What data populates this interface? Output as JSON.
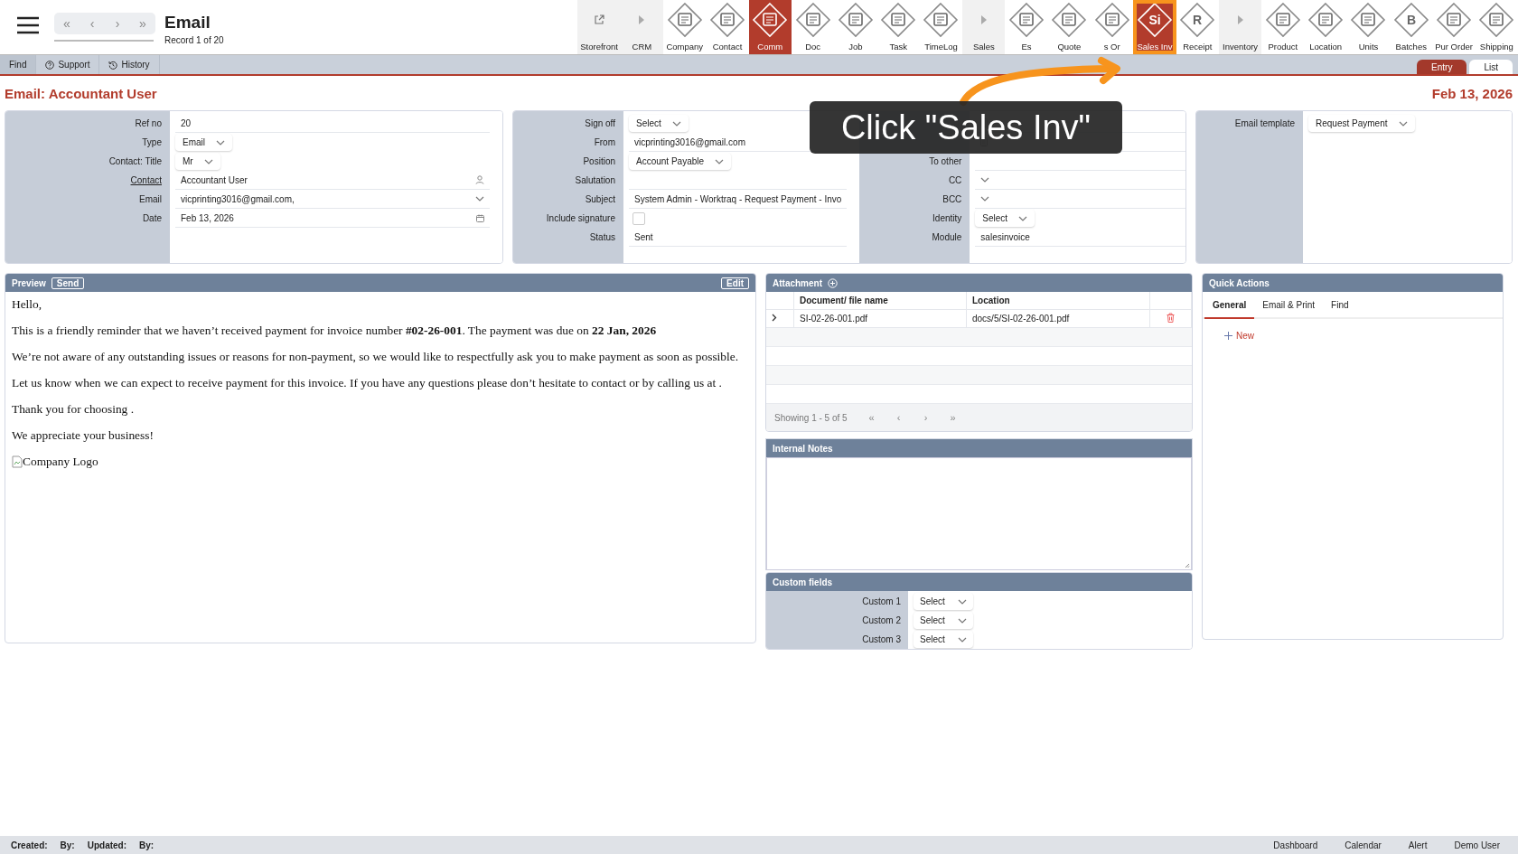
{
  "header": {
    "nav": [
      "«",
      "‹",
      "›",
      "»"
    ],
    "title": "Email",
    "record": "Record 1 of 20",
    "tools": [
      {
        "label": "Storefront",
        "kind": "link",
        "active": false,
        "highlighted": false
      },
      {
        "label": "CRM",
        "kind": "section",
        "active": false,
        "highlighted": false
      },
      {
        "label": "Company",
        "kind": "module",
        "active": false,
        "highlighted": false
      },
      {
        "label": "Contact",
        "kind": "module",
        "active": false,
        "highlighted": false
      },
      {
        "label": "Comm",
        "kind": "module",
        "active": true,
        "highlighted": false
      },
      {
        "label": "Doc",
        "kind": "module",
        "active": false,
        "highlighted": false
      },
      {
        "label": "Job",
        "kind": "module",
        "active": false,
        "highlighted": false
      },
      {
        "label": "Task",
        "kind": "module",
        "active": false,
        "highlighted": false
      },
      {
        "label": "TimeLog",
        "kind": "module",
        "active": false,
        "highlighted": false
      },
      {
        "label": "Sales",
        "kind": "section",
        "active": false,
        "highlighted": false
      },
      {
        "label": "Es",
        "kind": "module",
        "active": false,
        "highlighted": false
      },
      {
        "label": "Quote",
        "kind": "module",
        "active": false,
        "highlighted": false
      },
      {
        "label": "s Or",
        "kind": "module",
        "active": false,
        "highlighted": false
      },
      {
        "label": "Sales Inv",
        "kind": "module",
        "glyph": "Si",
        "active": true,
        "highlighted": true
      },
      {
        "label": "Receipt",
        "kind": "module",
        "glyph": "R",
        "active": false,
        "highlighted": false
      },
      {
        "label": "Inventory",
        "kind": "section",
        "active": false,
        "highlighted": false
      },
      {
        "label": "Product",
        "kind": "module",
        "active": false,
        "highlighted": false
      },
      {
        "label": "Location",
        "kind": "module",
        "active": false,
        "highlighted": false
      },
      {
        "label": "Units",
        "kind": "module",
        "active": false,
        "highlighted": false
      },
      {
        "label": "Batches",
        "kind": "module",
        "glyph": "B",
        "active": false,
        "highlighted": false
      },
      {
        "label": "Pur Order",
        "kind": "module",
        "active": false,
        "highlighted": false
      },
      {
        "label": "Shipping",
        "kind": "module",
        "active": false,
        "highlighted": false
      }
    ]
  },
  "subbar": {
    "items": [
      {
        "label": "Find",
        "kind": "plain"
      },
      {
        "label": "Support",
        "kind": "help"
      },
      {
        "label": "History",
        "kind": "history"
      }
    ],
    "views": [
      {
        "label": "Entry",
        "selected": true
      },
      {
        "label": "List",
        "selected": false
      }
    ]
  },
  "page_title": "Email: Accountant User",
  "page_date": "Feb 13, 2026",
  "form": {
    "panels": [
      {
        "columns": [
          {
            "fields": [
              {
                "label": "Ref no",
                "kind": "text",
                "value": "20",
                "label_link": false
              },
              {
                "label": "Type",
                "kind": "select",
                "value": "Email",
                "label_link": false
              },
              {
                "label": "Contact: Title",
                "kind": "select",
                "value": "Mr",
                "label_link": false
              },
              {
                "label": "Contact",
                "kind": "person-lookup",
                "value": "Accountant User",
                "label_link": true
              },
              {
                "label": "Email",
                "kind": "dropdown",
                "value": "vicprinting3016@gmail.com,",
                "label_link": false
              },
              {
                "label": "Date",
                "kind": "date",
                "value": "Feb 13, 2026",
                "label_link": false
              }
            ]
          }
        ]
      },
      {
        "columns": [
          {
            "fields": [
              {
                "label": "Sign off",
                "kind": "select",
                "value": "Select",
                "label_link": false
              },
              {
                "label": "From",
                "kind": "text",
                "value": "vicprinting3016@gmail.com",
                "label_link": false
              },
              {
                "label": "Position",
                "kind": "select",
                "value": "Account Payable",
                "label_link": false
              },
              {
                "label": "Salutation",
                "kind": "text",
                "label_link": false
              },
              {
                "label": "Subject",
                "kind": "text",
                "value": "System Admin - Worktraq - Request Payment - Invo",
                "label_link": false
              },
              {
                "label": "Include signature",
                "kind": "checkbox",
                "checked": false,
                "label_link": false
              },
              {
                "label": "Status",
                "kind": "text",
                "value": "Sent",
                "label_link": false
              }
            ]
          },
          {
            "fields": [
              {
                "kind": "doc-lookup"
              },
              {
                "kind": "doc-lookup"
              },
              {
                "label": "To other",
                "kind": "text",
                "label_link": false
              },
              {
                "label": "CC",
                "kind": "dropdown",
                "label_link": false
              },
              {
                "label": "BCC",
                "kind": "dropdown",
                "label_link": false
              },
              {
                "label": "Identity",
                "kind": "select",
                "value": "Select",
                "label_link": false
              },
              {
                "label": "Module",
                "kind": "text",
                "value": "salesinvoice",
                "label_link": false
              }
            ]
          }
        ]
      },
      {
        "columns": [
          {
            "fields": [
              {
                "label": "Email template",
                "kind": "select",
                "value": "Request Payment",
                "label_link": false
              }
            ]
          }
        ]
      }
    ]
  },
  "preview": {
    "title": "Preview",
    "send": "Send",
    "edit": "Edit",
    "paragraphs": [
      "Hello,",
      "This is a friendly reminder that we haven’t received payment for invoice number **#02-26-001**. The payment was due on **22 Jan, 2026**",
      "We’re not aware of any outstanding issues or reasons for non-payment, so we would like to respectfully ask you to make payment as soon as possible.",
      "Let us know when we can expect to receive payment for this invoice. If you have any questions please don’t hesitate to contact or by calling us at .",
      "Thank you for choosing .",
      "We appreciate your business!"
    ],
    "logo_alt": "Company Logo"
  },
  "attachment": {
    "title": "Attachment",
    "columns": [
      "Document/ file name",
      "Location"
    ],
    "rows": [
      {
        "name": "SI-02-26-001.pdf",
        "location": "docs/5/SI-02-26-001.pdf"
      }
    ],
    "showing": "Showing 1 - 5 of 5",
    "pager": [
      "«",
      "‹",
      "›",
      "»"
    ]
  },
  "notes": {
    "title": "Internal Notes"
  },
  "custom_fields": {
    "title": "Custom fields",
    "fields": [
      {
        "label": "Custom 1",
        "value": "Select"
      },
      {
        "label": "Custom 2",
        "value": "Select"
      },
      {
        "label": "Custom 3",
        "value": "Select"
      }
    ]
  },
  "quick_actions": {
    "title": "Quick Actions",
    "tabs": [
      {
        "label": "General",
        "selected": true
      },
      {
        "label": "Email & Print",
        "selected": false
      },
      {
        "label": "Find",
        "selected": false
      }
    ],
    "new": "New"
  },
  "status_bar": {
    "left": [
      "Created:",
      "By:",
      "Updated:",
      "By:"
    ],
    "right": [
      "Dashboard",
      "Calendar",
      "Alert",
      "Demo User"
    ]
  },
  "tour": {
    "text": "Click \"Sales Inv\""
  }
}
